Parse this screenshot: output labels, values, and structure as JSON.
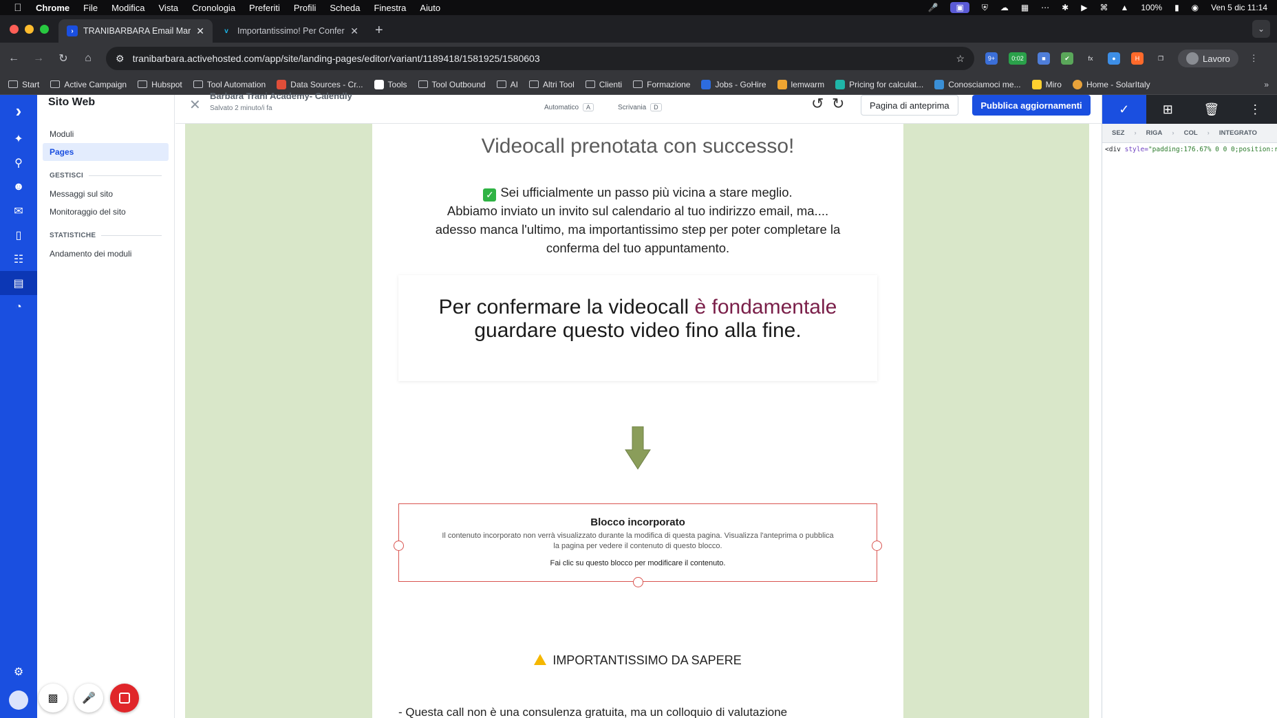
{
  "menubar": {
    "app": "Chrome",
    "items": [
      "File",
      "Modifica",
      "Vista",
      "Cronologia",
      "Preferiti",
      "Profili",
      "Scheda",
      "Finestra",
      "Aiuto"
    ],
    "battery": "100%",
    "datetime": "Ven 5 dic  11:14"
  },
  "tabs": [
    {
      "title": "TRANIBARBARA Email Marketing",
      "favicon": "activecampaign-favicon"
    },
    {
      "title": "Importantissimo! Per Conferma",
      "favicon": "vimeo-favicon"
    }
  ],
  "omnibox": {
    "url": "tranibarbara.activehosted.com/app/site/landing-pages/editor/variant/1189418/1581925/1580603"
  },
  "extensions": {
    "timer_badge": "0:02",
    "profile": "Lavoro"
  },
  "bookmarks": [
    {
      "label": "Start",
      "type": "folder"
    },
    {
      "label": "Active Campaign",
      "type": "folder"
    },
    {
      "label": "Hubspot",
      "type": "folder"
    },
    {
      "label": "Tool Automation",
      "type": "folder"
    },
    {
      "label": "Data Sources - Cr...",
      "type": "site"
    },
    {
      "label": "Tools",
      "type": "site"
    },
    {
      "label": "Tool Outbound",
      "type": "folder"
    },
    {
      "label": "AI",
      "type": "folder"
    },
    {
      "label": "Altri Tool",
      "type": "folder"
    },
    {
      "label": "Clienti",
      "type": "folder"
    },
    {
      "label": "Formazione",
      "type": "folder"
    },
    {
      "label": "Jobs - GoHire",
      "type": "site"
    },
    {
      "label": "lemwarm",
      "type": "site"
    },
    {
      "label": "Pricing for calculat...",
      "type": "site"
    },
    {
      "label": "Conosciamoci me...",
      "type": "site"
    },
    {
      "label": "Miro",
      "type": "site"
    },
    {
      "label": "Home - SolarItaly",
      "type": "site"
    }
  ],
  "sidebar": {
    "title": "Sito Web",
    "items": [
      "Moduli",
      "Pages"
    ],
    "section_manage": "GESTISCI",
    "manage_items": [
      "Messaggi sul sito",
      "Monitoraggio del sito"
    ],
    "section_stats": "STATISTICHE",
    "stats_items": [
      "Andamento dei moduli"
    ]
  },
  "editor": {
    "page_name": "Barbara Trani Academy- Calendly",
    "saved": "Salvato 2 minuto/i fa",
    "mode_auto": "Automatico",
    "mode_auto_key": "A",
    "mode_desk": "Scrivania",
    "mode_desk_key": "D",
    "preview_label": "Pagina di anteprima",
    "publish_label": "Pubblica aggiornamenti"
  },
  "page": {
    "headline": "Videocall prenotata con successo!",
    "intro_line1": "Sei ufficialmente un passo più vicina a stare meglio.",
    "intro_line2": "Abbiamo inviato un invito sul calendario al tuo indirizzo email, ma....",
    "intro_line3": "adesso manca l'ultimo, ma importantissimo step per poter completare la",
    "intro_line4": "conferma del tuo appuntamento.",
    "confirm_part1": "Per confermare la videocall ",
    "confirm_emphasis": "è fondamentale",
    "confirm_part2": "guardare questo video fino alla fine.",
    "embed_title": "Blocco incorporato",
    "embed_desc": "Il contenuto incorporato non verrà visualizzato durante la modifica di questa pagina. Visualizza l'anteprima o pubblica la pagina per vedere il contenuto di questo blocco.",
    "embed_hint": "Fai clic su questo blocco per modificare il contenuto.",
    "important_heading": "IMPORTANTISSIMO DA SAPERE",
    "bullet1": "- Questa call non è una consulenza gratuita, ma un colloquio di valutazione"
  },
  "panel": {
    "crumbs": [
      "SEZ",
      "RIGA",
      "COL",
      "INTEGRATO"
    ],
    "code_tag": "<div",
    "code_attr": " style=",
    "code_value": "\"padding:176.67% 0 0 0;position:r"
  },
  "colors": {
    "accent": "#1a4fe0",
    "page_bg": "#d9e7c9",
    "embed_border": "#d9534f",
    "emphasis": "#7a1f49"
  }
}
